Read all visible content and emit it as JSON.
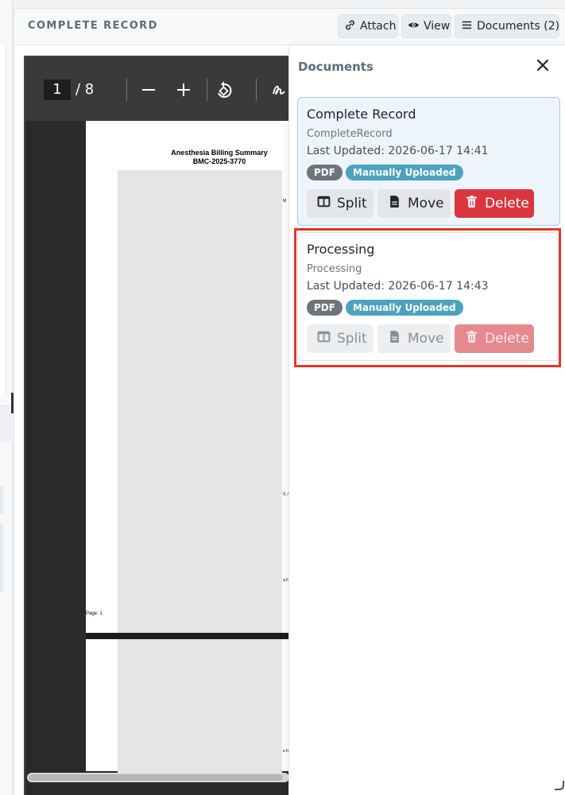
{
  "header": {
    "title": "COMPLETE RECORD",
    "attach_label": "Attach",
    "view_label": "View",
    "documents_label": "Documents (2)"
  },
  "viewer": {
    "current_page": "1",
    "total_pages": "/ 8",
    "document_title_line1": "Anesthesia Billing Summary",
    "document_title_line2": "BMC-2025-3770",
    "page_footer": "Page: 1"
  },
  "drawer": {
    "title": "Documents",
    "documents": [
      {
        "name": "Complete Record",
        "type": "CompleteRecord",
        "updated": "Last Updated: 2026-06-17 14:41",
        "format_badge": "PDF",
        "source_badge": "Manually Uploaded",
        "split_label": "Split",
        "move_label": "Move",
        "delete_label": "Delete",
        "state": "selected"
      },
      {
        "name": "Processing",
        "type": "Processing",
        "updated": "Last Updated: 2026-06-17 14:43",
        "format_badge": "PDF",
        "source_badge": "Manually Uploaded",
        "split_label": "Split",
        "move_label": "Move",
        "delete_label": "Delete",
        "state": "disabled"
      }
    ]
  },
  "colors": {
    "accent_selected": "#eef4fc",
    "delete": "#d9363e",
    "highlight": "#e5352b",
    "badge_source": "#4ba3bf"
  }
}
